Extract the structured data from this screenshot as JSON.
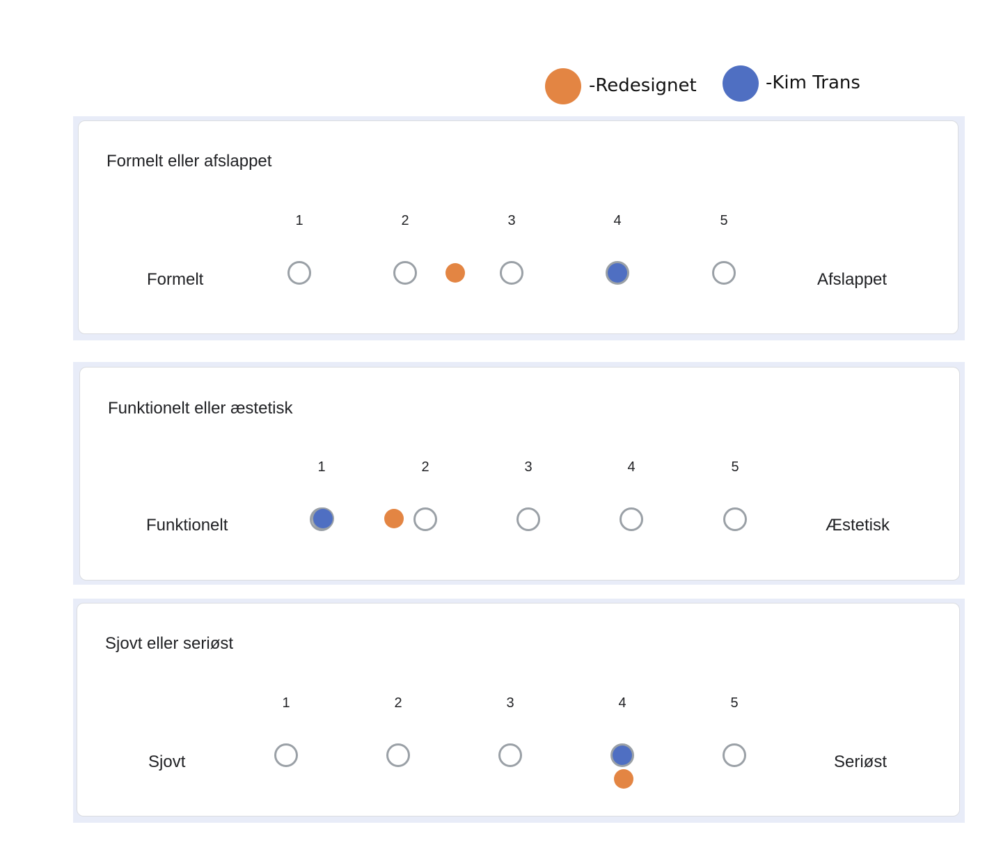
{
  "legend": {
    "items": [
      {
        "label": "-Redesignet",
        "color": "#e38543"
      },
      {
        "label": "-Kim Trans",
        "color": "#4f6fc2"
      }
    ]
  },
  "scale": [
    "1",
    "2",
    "3",
    "4",
    "5"
  ],
  "questions": [
    {
      "title": "Formelt eller afslappet",
      "left_label": "Formelt",
      "right_label": "Afslappet",
      "redesignet_value": 2.5,
      "kim_trans_value": 4
    },
    {
      "title": "Funktionelt eller æstetisk",
      "left_label": "Funktionelt",
      "right_label": "Æstetisk",
      "redesignet_value": 1.7,
      "kim_trans_value": 1
    },
    {
      "title": "Sjovt eller seriøst",
      "left_label": "Sjovt",
      "right_label": "Seriøst",
      "redesignet_value": 4,
      "kim_trans_value": 4
    }
  ]
}
